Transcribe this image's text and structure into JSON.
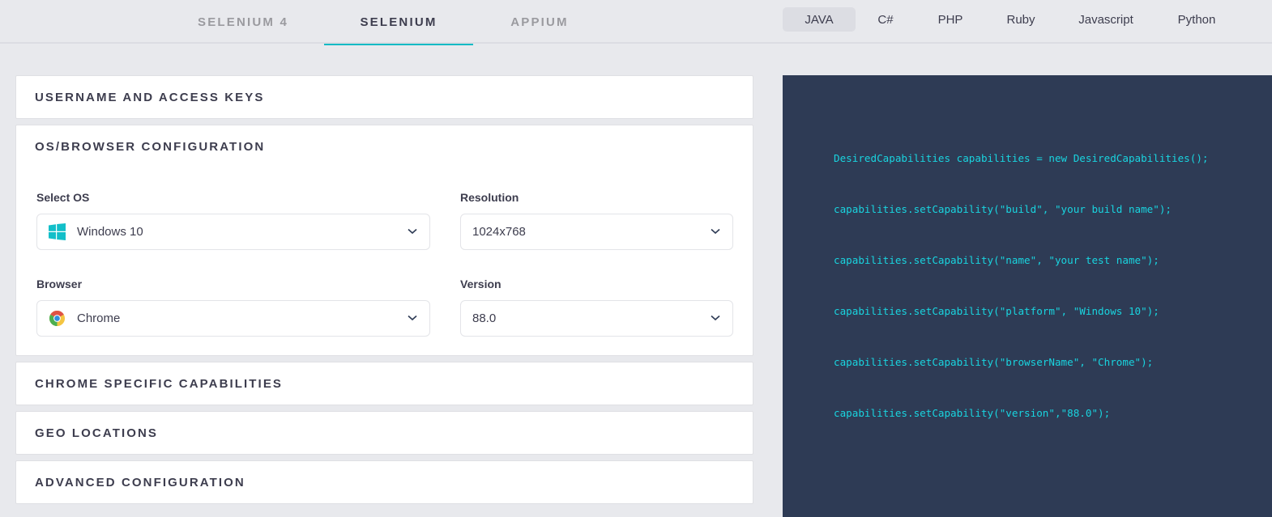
{
  "framework_tabs": [
    {
      "label": "SELENIUM 4",
      "active": false
    },
    {
      "label": "SELENIUM",
      "active": true
    },
    {
      "label": "APPIUM",
      "active": false
    }
  ],
  "language_tabs": [
    {
      "label": "JAVA",
      "active": true
    },
    {
      "label": "C#",
      "active": false
    },
    {
      "label": "PHP",
      "active": false
    },
    {
      "label": "Ruby",
      "active": false
    },
    {
      "label": "Javascript",
      "active": false
    },
    {
      "label": "Python",
      "active": false
    }
  ],
  "sections": {
    "username": {
      "title": "USERNAME AND ACCESS KEYS"
    },
    "os_browser": {
      "title": "OS/BROWSER CONFIGURATION",
      "fields": {
        "os": {
          "label": "Select OS",
          "value": "Windows 10",
          "icon": "windows-icon"
        },
        "resolution": {
          "label": "Resolution",
          "value": "1024x768"
        },
        "browser": {
          "label": "Browser",
          "value": "Chrome",
          "icon": "chrome-icon"
        },
        "version": {
          "label": "Version",
          "value": "88.0"
        }
      }
    },
    "chrome_caps": {
      "title": "CHROME SPECIFIC CAPABILITIES"
    },
    "geo": {
      "title": "GEO LOCATIONS"
    },
    "advanced": {
      "title": "ADVANCED CONFIGURATION"
    }
  },
  "code": {
    "lines": [
      "DesiredCapabilities capabilities = new DesiredCapabilities();",
      "capabilities.setCapability(\"build\", \"your build name\");",
      "capabilities.setCapability(\"name\", \"your test name\");",
      "capabilities.setCapability(\"platform\", \"Windows 10\");",
      "capabilities.setCapability(\"browserName\", \"Chrome\");",
      "capabilities.setCapability(\"version\",\"88.0\");"
    ]
  },
  "colors": {
    "accent": "#0ebac5",
    "code_bg": "#2e3b55",
    "code_text": "#19d4df",
    "page_bg": "#e8e9ed"
  }
}
